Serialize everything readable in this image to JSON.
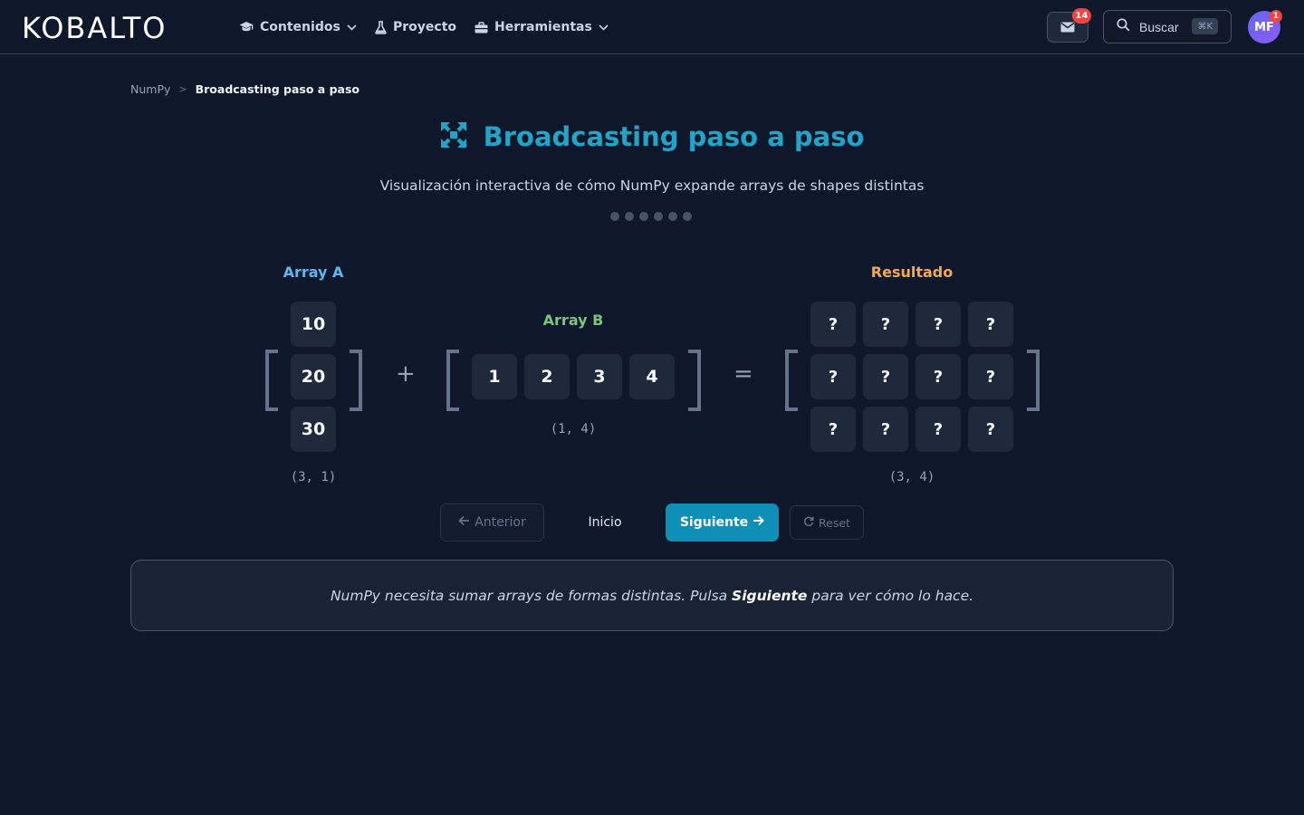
{
  "header": {
    "logo": "KOBALTO",
    "nav": [
      {
        "label": "Contenidos",
        "icon": "graduation-cap-icon",
        "dropdown": true
      },
      {
        "label": "Proyecto",
        "icon": "flask-icon",
        "dropdown": false
      },
      {
        "label": "Herramientas",
        "icon": "toolbox-icon",
        "dropdown": true
      }
    ],
    "mail_badge": "14",
    "search": {
      "label": "Buscar",
      "shortcut": "⌘K"
    },
    "avatar": {
      "initials": "MF",
      "badge": "1"
    }
  },
  "breadcrumb": {
    "parent": "NumPy",
    "separator": ">",
    "current": "Broadcasting paso a paso"
  },
  "page": {
    "title": "Broadcasting paso a paso",
    "title_icon": "expand-arrows-icon",
    "subtitle": "Visualización interactiva de cómo NumPy expande arrays de shapes distintas",
    "step_dots": 6
  },
  "arrays": {
    "a": {
      "label": "Array A",
      "values": [
        "10",
        "20",
        "30"
      ],
      "shape": "(3, 1)",
      "color": "#5eb8f0"
    },
    "b": {
      "label": "Array B",
      "values": [
        "1",
        "2",
        "3",
        "4"
      ],
      "shape": "(1, 4)",
      "color": "#7cc47f"
    },
    "result": {
      "label": "Resultado",
      "values": [
        [
          "?",
          "?",
          "?",
          "?"
        ],
        [
          "?",
          "?",
          "?",
          "?"
        ],
        [
          "?",
          "?",
          "?",
          "?"
        ]
      ],
      "shape": "(3, 4)",
      "color": "#f5a94e"
    },
    "plus": "+",
    "equals": "="
  },
  "controls": {
    "prev": "Anterior",
    "start": "Inicio",
    "next": "Siguiente",
    "reset": "Reset"
  },
  "info": {
    "before": "NumPy necesita sumar arrays de formas distintas. Pulsa ",
    "bold": "Siguiente",
    "after": " para ver cómo lo hace."
  }
}
